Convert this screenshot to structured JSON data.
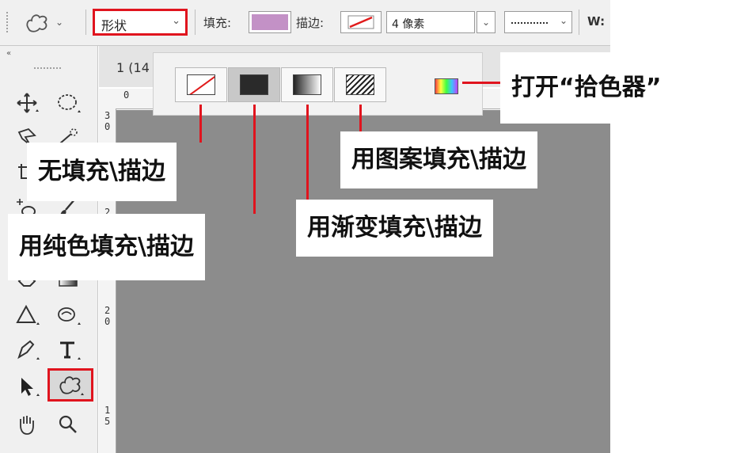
{
  "toolbar": {
    "mode_value": "形状",
    "fill_label": "填充:",
    "stroke_label": "描边:",
    "stroke_width": "4 像素",
    "w_label": "W:"
  },
  "colors": {
    "fill": "#c391c6",
    "highlight": "#e0141e",
    "canvas": "#8c8c8c"
  },
  "document": {
    "tab_title": "1 (14"
  },
  "rulers": {
    "top": [
      "0"
    ],
    "left": [
      {
        "digits": [
          "3",
          "0"
        ]
      },
      {
        "digits": [
          "2"
        ]
      },
      {
        "digits": [
          "2",
          "0"
        ]
      },
      {
        "digits": [
          "1",
          "5"
        ]
      }
    ]
  },
  "popup": {
    "options": [
      {
        "id": "none",
        "icon": "no-fill-icon"
      },
      {
        "id": "solid",
        "icon": "solid-color-icon",
        "active": true
      },
      {
        "id": "gradient",
        "icon": "gradient-icon"
      },
      {
        "id": "pattern",
        "icon": "pattern-icon"
      }
    ],
    "picker_icon": "color-picker-icon"
  },
  "callouts": {
    "none": "无填充\\描边",
    "solid": "用纯色填充\\描边",
    "gradient": "用渐变填充\\描边",
    "pattern": "用图案填充\\描边",
    "picker": "打开“拾色器”"
  },
  "tools": [
    "move-tool-icon",
    "ellipse-marquee-tool-icon",
    "lasso-tool-icon",
    "quick-selection-tool-icon",
    "crop-tool-icon",
    "eyedropper-tool-icon",
    "spot-healing-tool-icon",
    "brush-tool-icon",
    "eraser-tool-icon",
    "gradient-tool-icon",
    "blur-tool-icon",
    "dodge-tool-icon",
    "pen-tool-icon",
    "type-tool-icon",
    "path-selection-tool-icon",
    "custom-shape-tool-icon",
    "hand-tool-icon",
    "zoom-tool-icon"
  ]
}
